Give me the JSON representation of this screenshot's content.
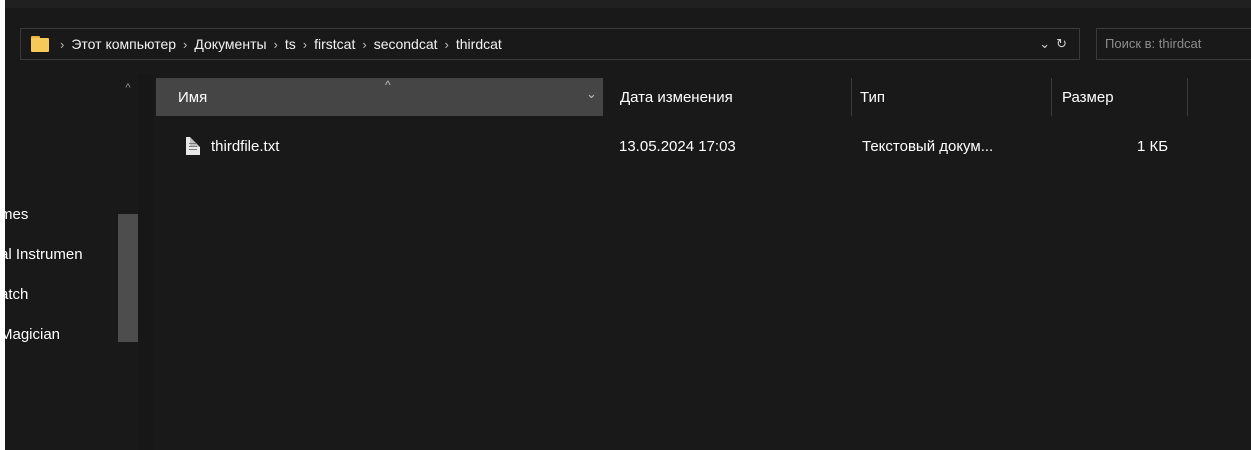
{
  "breadcrumb": [
    "Этот компьютер",
    "Документы",
    "ts",
    "firstcat",
    "secondcat",
    "thirdcat"
  ],
  "address": {
    "dropdown_glyph": "⌄",
    "refresh_glyph": "↻"
  },
  "search": {
    "placeholder": "Поиск в: thirdcat"
  },
  "nav": {
    "scroll_up_glyph": "^",
    "items": [
      {
        "label": "mes"
      },
      {
        "label": "al Instrumen"
      },
      {
        "label": "atch"
      },
      {
        "label": "Magician"
      }
    ]
  },
  "columns": {
    "name": "Имя",
    "date": "Дата изменения",
    "type": "Тип",
    "size": "Размер",
    "sort_glyph": "^",
    "filter_glyph": "⌄"
  },
  "files": [
    {
      "name": "thirdfile.txt",
      "date": "13.05.2024 17:03",
      "type": "Текстовый докум...",
      "size": "1 КБ",
      "icon": "text-file-icon"
    }
  ],
  "colors": {
    "background": "#191919",
    "header_selected": "#454545",
    "folder": "#f6c85a"
  }
}
